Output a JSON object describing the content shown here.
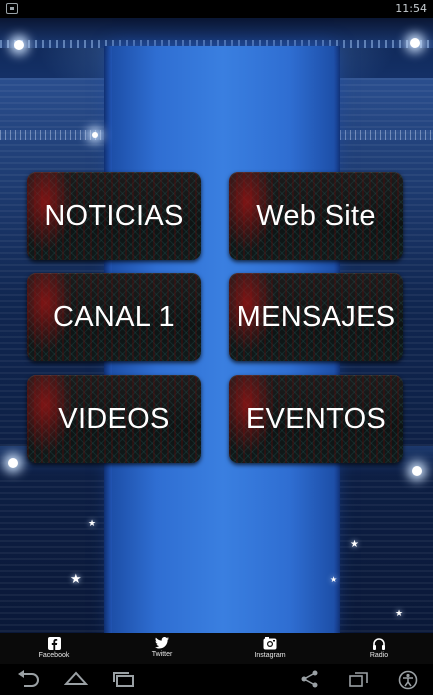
{
  "status_bar": {
    "time": "11:54"
  },
  "menu": {
    "buttons": [
      {
        "label": "NOTICIAS"
      },
      {
        "label": "Web Site"
      },
      {
        "label": "CANAL 1"
      },
      {
        "label": "MENSAJES"
      },
      {
        "label": "VIDEOS"
      },
      {
        "label": "EVENTOS"
      }
    ]
  },
  "tabbar": {
    "tabs": [
      {
        "label": "Facebook",
        "icon": "facebook-icon"
      },
      {
        "label": "Twitter",
        "icon": "twitter-icon"
      },
      {
        "label": "Instagram",
        "icon": "instagram-icon"
      },
      {
        "label": "Radio",
        "icon": "headphones-icon"
      }
    ]
  },
  "navbar": {
    "icons": [
      "back-icon",
      "home-icon",
      "recent-apps-icon",
      "share-icon",
      "screen-rotate-icon",
      "accessibility-icon"
    ]
  },
  "colors": {
    "button_accent": "#a01414",
    "tabbar_bg": "#0a0a0a",
    "banner": "#2f6ed2"
  }
}
